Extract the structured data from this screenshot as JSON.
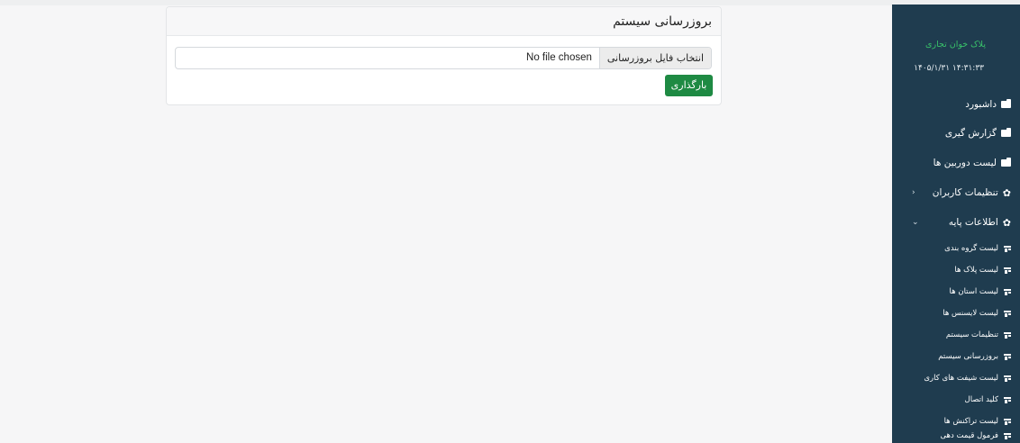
{
  "card": {
    "title": "بروزرسانی سیستم",
    "file_button_label": "انتخاب فایل بروزرسانی",
    "file_status": "No file chosen",
    "upload_label": "بارگذاری"
  },
  "sidebar": {
    "brand": "پلاک خوان تجاری",
    "datetime": "۱۴۰۵/۱/۳۱ ۱۴:۳۱:۳۳",
    "items": [
      {
        "label": "داشبورد",
        "icon": "folder-icon"
      },
      {
        "label": "گزارش گیری",
        "icon": "folder-icon"
      },
      {
        "label": "لیست دوربین ها",
        "icon": "folder-icon"
      },
      {
        "label": "تنظیمات کاربران",
        "icon": "gear-icon",
        "chevron": "‹"
      },
      {
        "label": "اطلاعات پایه",
        "icon": "gear-icon",
        "chevron": "⌄"
      }
    ],
    "sub_items": [
      {
        "label": "لیست گروه بندی"
      },
      {
        "label": "لیست پلاک ها"
      },
      {
        "label": "لیست استان ها"
      },
      {
        "label": "لیست لایسنس ها"
      },
      {
        "label": "تنظیمات سیستم"
      },
      {
        "label": "بروزرسانی سیستم"
      },
      {
        "label": "لیست شیفت های کاری"
      },
      {
        "label": "کلید اتصال"
      },
      {
        "label": "لیست تراکنش ها"
      },
      {
        "label": "فرمول قیمت دهی"
      }
    ]
  },
  "colors": {
    "sidebar_bg": "#1f3c4f",
    "brand_green": "#39c26a",
    "upload_green": "#1e8a43"
  }
}
